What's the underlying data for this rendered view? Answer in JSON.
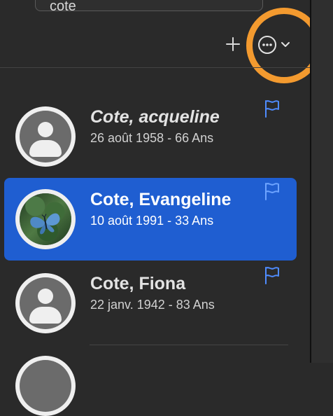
{
  "search": {
    "value": "cote"
  },
  "toolbar": {
    "add_icon": "plus-icon",
    "more_icon": "ellipsis-circle-icon",
    "chevron_icon": "chevron-down-icon"
  },
  "contacts": [
    {
      "name": "Cote, acqueline",
      "meta": "26 août 1958 - 66 Ans",
      "selected": false,
      "italic": true,
      "avatar": "person-icon"
    },
    {
      "name": "Cote, Evangeline",
      "meta": "10 août 1991 - 33 Ans",
      "selected": true,
      "italic": false,
      "avatar": "butterfly-photo"
    },
    {
      "name": "Cote, Fiona",
      "meta": "22 janv. 1942 - 83 Ans",
      "selected": false,
      "italic": false,
      "avatar": "person-icon"
    }
  ],
  "colors": {
    "accent_selected": "#1f5ed1",
    "highlight_ring": "#f39a2f",
    "flag_blue": "#4f8cff"
  }
}
